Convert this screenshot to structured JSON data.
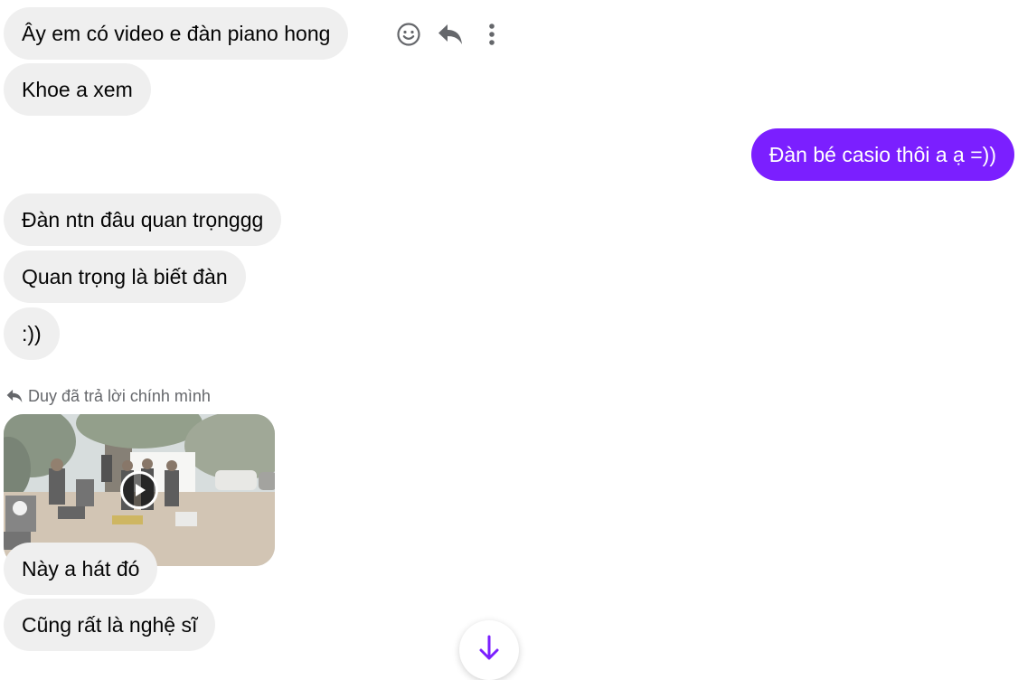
{
  "messages": {
    "m1": "Ây em có video e đàn piano hong",
    "m2": "Khoe a xem",
    "m3": "Đàn bé casio thôi a ạ =))",
    "m4": "Đàn ntn đâu quan trọnggg",
    "m5": "Quan trọng là biết đàn",
    "m6": ":))",
    "m7": "Này a hát đó",
    "m8": "Cũng rất là nghệ sĩ"
  },
  "reply_note": {
    "text": "Duy đã trả lời chính mình",
    "icon": "reply-icon"
  },
  "hover_actions": {
    "icons": [
      "smiley-icon",
      "reply-icon",
      "more-vertical-icon"
    ]
  },
  "video": {
    "icon": "play-icon"
  },
  "scroll_button": {
    "icon": "arrow-down-icon"
  },
  "colors": {
    "outgoing_bubble": "#7b1fff",
    "incoming_bubble": "#efefef",
    "accent": "#7b1fff"
  }
}
